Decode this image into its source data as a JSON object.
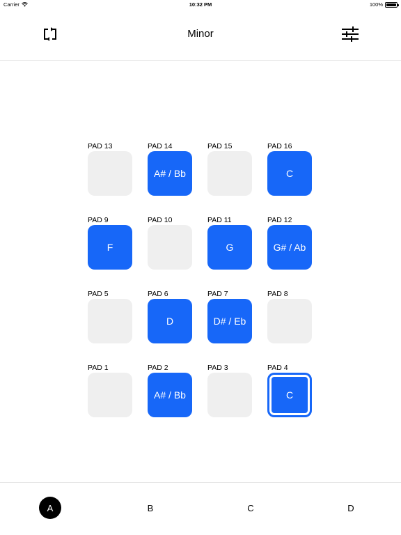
{
  "status_bar": {
    "carrier": "Carrier",
    "time": "10:32 PM",
    "battery": "100%",
    "battery_level": 1.0
  },
  "nav": {
    "title": "Minor",
    "left_icon": "repeat-icon",
    "right_icon": "sliders-icon"
  },
  "colors": {
    "pad_on": "#1767f8",
    "pad_off": "#efefef",
    "active_tab": "#000000"
  },
  "pad_rows": [
    [
      {
        "label": "PAD 13",
        "note": "",
        "on": false
      },
      {
        "label": "PAD 14",
        "note": "A# / Bb",
        "on": true
      },
      {
        "label": "PAD 15",
        "note": "",
        "on": false
      },
      {
        "label": "PAD 16",
        "note": "C",
        "on": true
      }
    ],
    [
      {
        "label": "PAD 9",
        "note": "F",
        "on": true
      },
      {
        "label": "PAD 10",
        "note": "",
        "on": false
      },
      {
        "label": "PAD 11",
        "note": "G",
        "on": true
      },
      {
        "label": "PAD 12",
        "note": "G# / Ab",
        "on": true
      }
    ],
    [
      {
        "label": "PAD 5",
        "note": "",
        "on": false
      },
      {
        "label": "PAD 6",
        "note": "D",
        "on": true
      },
      {
        "label": "PAD 7",
        "note": "D# / Eb",
        "on": true
      },
      {
        "label": "PAD 8",
        "note": "",
        "on": false
      }
    ],
    [
      {
        "label": "PAD 1",
        "note": "",
        "on": false
      },
      {
        "label": "PAD 2",
        "note": "A# / Bb",
        "on": true
      },
      {
        "label": "PAD 3",
        "note": "",
        "on": false
      },
      {
        "label": "PAD 4",
        "note": "C",
        "on": true,
        "selected": true
      }
    ]
  ],
  "tabs": [
    {
      "label": "A",
      "active": true
    },
    {
      "label": "B",
      "active": false
    },
    {
      "label": "C",
      "active": false
    },
    {
      "label": "D",
      "active": false
    }
  ]
}
